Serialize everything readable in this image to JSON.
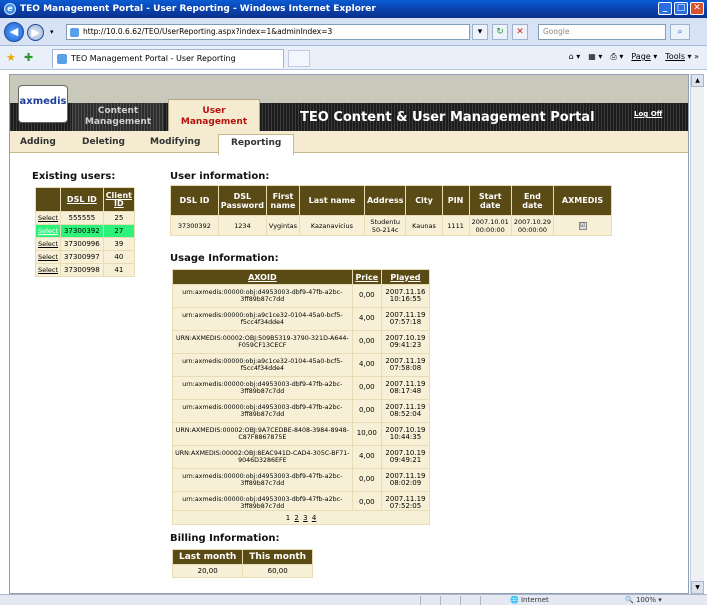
{
  "browser": {
    "window_title": "TEO Management Portal - User Reporting - Windows Internet Explorer",
    "url": "http://10.0.6.62/TEO/UserReporting.aspx?index=1&adminIndex=3",
    "search_placeholder": "Google",
    "tab_title": "TEO Management Portal - User Reporting",
    "toolbar": {
      "page": "Page",
      "tools": "Tools"
    },
    "status": {
      "zone": "Internet",
      "zoom": "100%"
    }
  },
  "header": {
    "logo": "axmedis",
    "content_management": [
      "Content",
      "Management"
    ],
    "user_management": [
      "User",
      "Management"
    ],
    "portal_title": "TEO Content & User Management Portal",
    "logoff": "Log Off"
  },
  "subnav": {
    "items": [
      "Adding",
      "Deleting",
      "Modifying",
      "Reporting"
    ],
    "active": "Reporting"
  },
  "existing_users": {
    "title": "Existing users:",
    "columns": [
      "",
      "DSL ID",
      "Client ID"
    ],
    "rows": [
      {
        "action": "Select",
        "dsl_id": "555555",
        "client_id": "25"
      },
      {
        "action": "Select",
        "dsl_id": "37300392",
        "client_id": "27"
      },
      {
        "action": "Select",
        "dsl_id": "37300996",
        "client_id": "39"
      },
      {
        "action": "Select",
        "dsl_id": "37300997",
        "client_id": "40"
      },
      {
        "action": "Select",
        "dsl_id": "37300998",
        "client_id": "41"
      }
    ],
    "selected_index": 1
  },
  "user_information": {
    "title": "User information:",
    "columns": [
      "DSL ID",
      "DSL Password",
      "First name",
      "Last name",
      "Address",
      "City",
      "PIN",
      "Start date",
      "End date",
      "AXMEDIS"
    ],
    "row": {
      "dsl_id": "37300392",
      "password": "1234",
      "first_name": "Vygintas",
      "last_name": "Kazanavicius",
      "address": "Studentu 50-214c",
      "city": "Kaunas",
      "pin": "1111",
      "start_date": "2007.10.01 00:00:00",
      "end_date": "2007.10.29 00:00:00",
      "axmedis": "☑"
    }
  },
  "usage_information": {
    "title": "Usage Information:",
    "columns": [
      "AXOID",
      "Price",
      "Played"
    ],
    "rows": [
      {
        "axoid": "urn:axmedis:00000:obj:d4953003-dbf9-47fb-a2bc-3ff89b87c7dd",
        "price": "0,00",
        "played": "2007.11.16 10:16:55"
      },
      {
        "axoid": "urn:axmedis:00000:obj:a9c1ce32-0104-45a0-bcf5-f5cc4f34dde4",
        "price": "4,00",
        "played": "2007.11.19 07:57:18"
      },
      {
        "axoid": "URN:AXMEDIS:00002:OBJ:509B5319-3790-321D-A644-F059CF13CECF",
        "price": "0,00",
        "played": "2007.10.19 09:41:23"
      },
      {
        "axoid": "urn:axmedis:00000:obj:a9c1ce32-0104-45a0-bcf5-f5cc4f34dde4",
        "price": "4,00",
        "played": "2007.11.19 07:58:08"
      },
      {
        "axoid": "urn:axmedis:00000:obj:d4953003-dbf9-47fb-a2bc-3ff89b87c7dd",
        "price": "0,00",
        "played": "2007.11.19 08:17:48"
      },
      {
        "axoid": "urn:axmedis:00000:obj:d4953003-dbf9-47fb-a2bc-3ff89b87c7dd",
        "price": "0,00",
        "played": "2007.11.19 08:52:04"
      },
      {
        "axoid": "URN:AXMEDIS:00002:OBJ:9A7CEDBE-8408-3984-8948-C87F8867875E",
        "price": "10,00",
        "played": "2007.10.19 10:44:35"
      },
      {
        "axoid": "URN:AXMEDIS:00002:OBJ:8EAC941D-CAD4-305C-BF71-9046D3286EFE",
        "price": "4,00",
        "played": "2007.10.19 09:49:21"
      },
      {
        "axoid": "urn:axmedis:00000:obj:d4953003-dbf9-47fb-a2bc-3ff89b87c7dd",
        "price": "0,00",
        "played": "2007.11.19 08:02:09"
      },
      {
        "axoid": "urn:axmedis:00000:obj:d4953003-dbf9-47fb-a2bc-3ff89b87c7dd",
        "price": "0,00",
        "played": "2007.11.19 07:52:05"
      }
    ],
    "pages": [
      "1",
      "2",
      "3",
      "4"
    ],
    "current_page": "1"
  },
  "billing_information": {
    "title": "Billing Information:",
    "columns": [
      "Last month",
      "This month"
    ],
    "values": [
      "20,00",
      "60,00"
    ]
  }
}
